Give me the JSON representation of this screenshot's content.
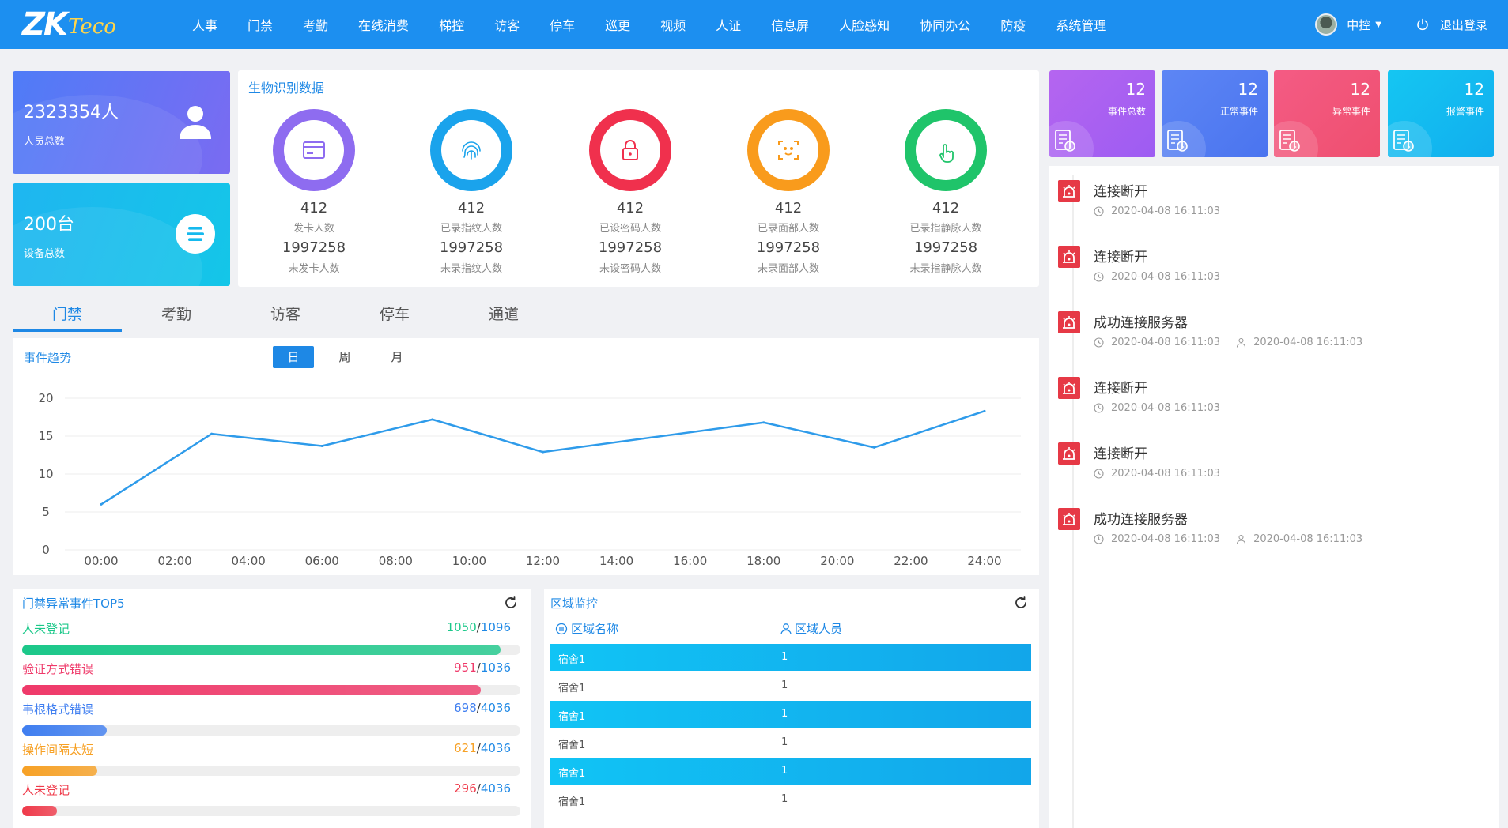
{
  "app": {
    "logo_main": "ZK",
    "logo_sub": "Teco",
    "nav": [
      "人事",
      "门禁",
      "考勤",
      "在线消费",
      "梯控",
      "访客",
      "停车",
      "巡更",
      "视频",
      "人证",
      "信息屏",
      "人脸感知",
      "协同办公",
      "防疫",
      "系统管理"
    ],
    "user": "中控",
    "logout": "退出登录"
  },
  "stats": {
    "people_value": "2323354人",
    "people_label": "人员总数",
    "devices_value": "200台",
    "devices_label": "设备总数"
  },
  "bio": {
    "title": "生物识别数据",
    "items": [
      {
        "value": "412",
        "label": "发卡人数",
        "value2": "1997258",
        "label2": "未发卡人数",
        "icon": "card-icon",
        "color": "#8e6cf0"
      },
      {
        "value": "412",
        "label": "已录指纹人数",
        "value2": "1997258",
        "label2": "未录指纹人数",
        "icon": "fingerprint-icon",
        "color": "#1aa3ec"
      },
      {
        "value": "412",
        "label": "已设密码人数",
        "value2": "1997258",
        "label2": "未设密码人数",
        "icon": "lock-icon",
        "color": "#f0304d"
      },
      {
        "value": "412",
        "label": "已录面部人数",
        "value2": "1997258",
        "label2": "未录面部人数",
        "icon": "face-scan-icon",
        "color": "#f99b1c"
      },
      {
        "value": "412",
        "label": "已录指静脉人数",
        "value2": "1997258",
        "label2": "未录指静脉人数",
        "icon": "hand-pointer-icon",
        "color": "#1fc46a"
      }
    ]
  },
  "tabs": [
    "门禁",
    "考勤",
    "访客",
    "停车",
    "通道"
  ],
  "trend": {
    "title": "事件趋势",
    "periods": [
      "日",
      "周",
      "月"
    ],
    "selected": "日"
  },
  "chart_data": {
    "type": "line",
    "title": "事件趋势",
    "x": [
      "00:00",
      "02:00",
      "04:00",
      "06:00",
      "08:00",
      "10:00",
      "12:00",
      "14:00",
      "16:00",
      "18:00",
      "20:00",
      "22:00",
      "24:00"
    ],
    "series": [
      {
        "values": [
          6,
          null,
          15.3,
          null,
          13.7,
          null,
          17.2,
          null,
          12.9,
          null,
          null,
          null,
          16.8,
          null,
          17.6,
          null,
          13.5,
          null,
          18.3
        ]
      }
    ],
    "points": [
      {
        "x": "00:00",
        "y": 6
      },
      {
        "x": "03:00",
        "y": 15.3
      },
      {
        "x": "06:00",
        "y": 13.7
      },
      {
        "x": "09:00",
        "y": 17.2
      },
      {
        "x": "12:00",
        "y": 12.9
      },
      {
        "x": "18:00",
        "y": 16.8
      },
      {
        "x": "21:00",
        "y": 13.5
      },
      {
        "x": "24:00",
        "y": 18.3
      }
    ],
    "yticks": [
      0,
      5,
      10,
      15,
      20
    ],
    "ylim": [
      0,
      20
    ],
    "grid": true,
    "color": "#2e9bea"
  },
  "top5": {
    "title": "门禁异常事件TOP5",
    "items": [
      {
        "label": "人未登记",
        "count": "1050",
        "total": "1096",
        "ratio": 0.96,
        "color": "#1cc88a"
      },
      {
        "label": "验证方式错误",
        "count": "951",
        "total": "1036",
        "ratio": 0.92,
        "color": "#ef3a6a"
      },
      {
        "label": "韦根格式错误",
        "count": "698",
        "total": "4036",
        "ratio": 0.17,
        "color": "#3f7ef0"
      },
      {
        "label": "操作间隔太短",
        "count": "621",
        "total": "4036",
        "ratio": 0.15,
        "color": "#f7a125"
      },
      {
        "label": "人未登记",
        "count": "296",
        "total": "4036",
        "ratio": 0.07,
        "color": "#ef3a4a"
      }
    ]
  },
  "area": {
    "title": "区域监控",
    "col_name": "区域名称",
    "col_people": "区域人员",
    "rows": [
      {
        "name": "宿舍1",
        "count": "1"
      },
      {
        "name": "宿舍1",
        "count": "1"
      },
      {
        "name": "宿舍1",
        "count": "1"
      },
      {
        "name": "宿舍1",
        "count": "1"
      },
      {
        "name": "宿舍1",
        "count": "1"
      },
      {
        "name": "宿舍1",
        "count": "1"
      }
    ]
  },
  "event_cards": [
    {
      "value": "12",
      "label": "事件总数"
    },
    {
      "value": "12",
      "label": "正常事件"
    },
    {
      "value": "12",
      "label": "异常事件"
    },
    {
      "value": "12",
      "label": "报警事件"
    }
  ],
  "events": [
    {
      "title": "连接断开",
      "time": "2020-04-08  16:11:03"
    },
    {
      "title": "连接断开",
      "time": "2020-04-08  16:11:03"
    },
    {
      "title": "成功连接服务器",
      "time": "2020-04-08  16:11:03",
      "time2": "2020-04-08  16:11:03"
    },
    {
      "title": "连接断开",
      "time": "2020-04-08  16:11:03"
    },
    {
      "title": "连接断开",
      "time": "2020-04-08  16:11:03"
    },
    {
      "title": "成功连接服务器",
      "time": "2020-04-08  16:11:03",
      "time2": "2020-04-08  16:11:03"
    }
  ]
}
